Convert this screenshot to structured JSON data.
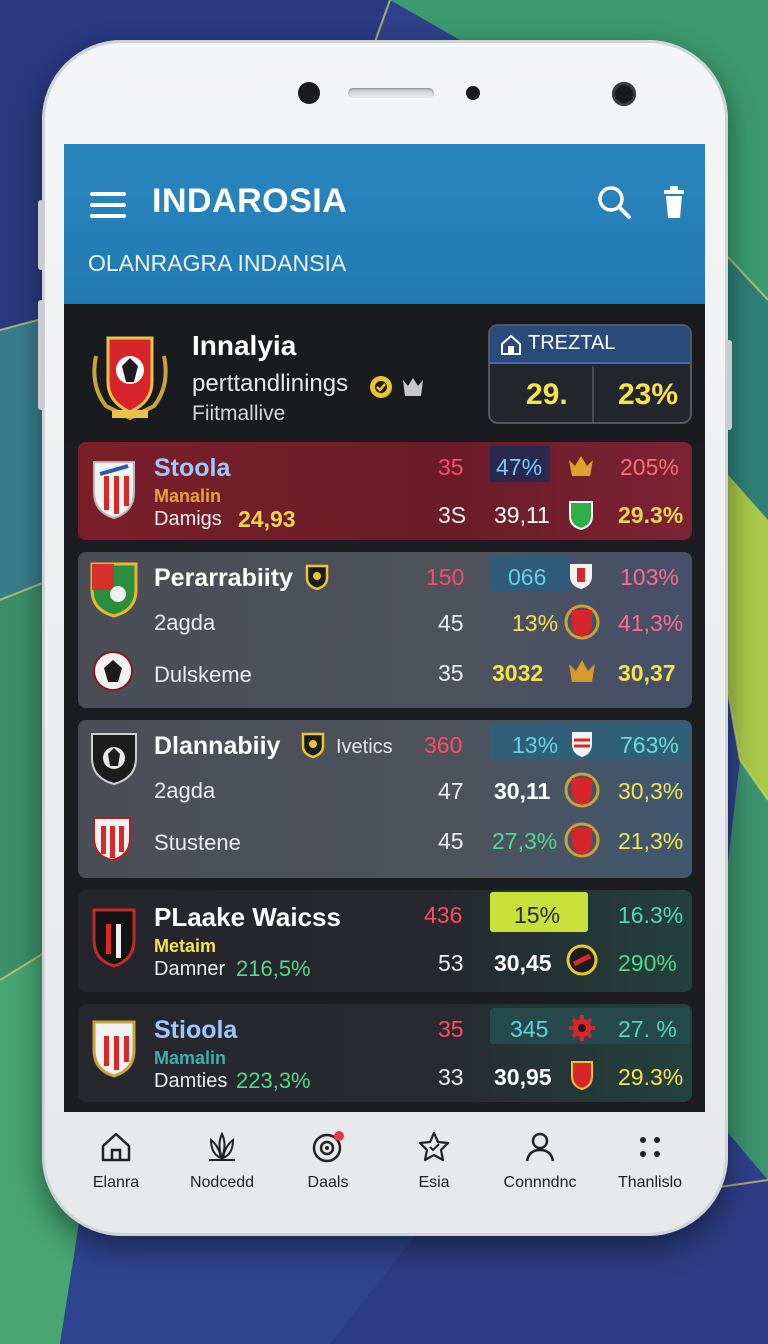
{
  "colors": {
    "appbar": "#2a86bf",
    "accent_yellow": "#f5e34c",
    "accent_red": "#e8405c",
    "accent_green": "#3ec27a",
    "accent_cyan": "#3ad0d8"
  },
  "header": {
    "title": "INDAROSIA",
    "subtitle": "OLANRAGRA INDANSIA",
    "menu_icon": "hamburger-menu-icon",
    "search_icon": "search-icon",
    "trash_icon": "trash-icon"
  },
  "featured": {
    "name": "Innalyia",
    "sub": "perttandlinings",
    "sub2": "Fiitmallive",
    "total_label": "TREZTAL",
    "total_left": "29.",
    "total_right": "23%"
  },
  "cards": [
    {
      "name": "Stoola",
      "meta": "Manalin",
      "label3": "Damigs",
      "value3": "24,93",
      "c1a": "35",
      "c2a": "47%",
      "c4a": "205%",
      "c1b": "3S",
      "c2b": "39,11",
      "c4b": "29.3%"
    },
    {
      "name": "Perarrabiity",
      "row2": "2agda",
      "row3": "Dulskeme",
      "c1a": "150",
      "c2a": "066",
      "c4a": "103%",
      "c1b": "45",
      "c2b": "13%",
      "c4b": "41,3%",
      "c1c": "35",
      "c2c": "3032",
      "c4c": "30,37"
    },
    {
      "name": "Dlannabiiy",
      "tag": "Ivetics",
      "row2": "2agda",
      "row3": "Stustene",
      "c1a": "360",
      "c2a": "13%",
      "c4a": "763%",
      "c1b": "47",
      "c2b": "30,11",
      "c4b": "30,3%",
      "c1c": "45",
      "c2c": "27,3%",
      "c4c": "21,3%"
    },
    {
      "name": "PLaake Waicss",
      "meta": "Metaim",
      "label3": "Damner",
      "value3": "216,5%",
      "c1a": "436",
      "c2a": "15%",
      "c4a": "16.3%",
      "c1b": "53",
      "c2b": "30,45",
      "c4b": "290%"
    },
    {
      "name": "Stioola",
      "meta": "Mamalin",
      "label3": "Damties",
      "value3": "223,3%",
      "c1a": "35",
      "c2a": "345",
      "c4a": "27. %",
      "c1b": "33",
      "c2b": "30,95",
      "c4b": "29.3%"
    }
  ],
  "nav": [
    {
      "label": "Elanra",
      "icon": "home-icon"
    },
    {
      "label": "Nodcedd",
      "icon": "lotus-icon"
    },
    {
      "label": "Daals",
      "icon": "target-icon",
      "has_dot": true
    },
    {
      "label": "Esia",
      "icon": "star-icon"
    },
    {
      "label": "Connndnc",
      "icon": "person-icon"
    },
    {
      "label": "Thanlislo",
      "icon": "grid-dots-icon"
    }
  ]
}
